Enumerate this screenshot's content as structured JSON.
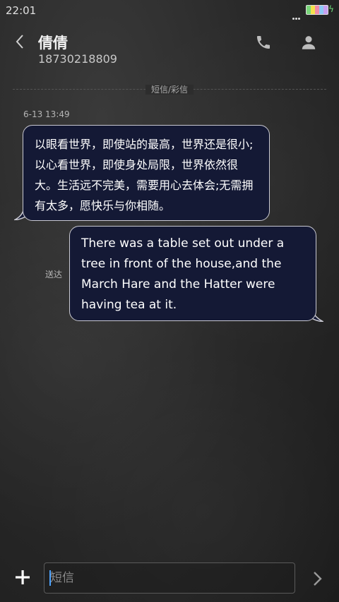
{
  "status_bar": {
    "time": "22:01"
  },
  "header": {
    "contact_name": "倩倩",
    "phone_number": "18730218809"
  },
  "channel": {
    "label": "短信/彩信"
  },
  "messages": [
    {
      "direction": "incoming",
      "timestamp": "6-13 13:49",
      "text": "以眼看世界，即使站的最高，世界还是很小;以心看世界，即使身处局限，世界依然很大。生活远不完美，需要用心去体会;无需拥有太多，愿快乐与你相随。"
    },
    {
      "direction": "outgoing",
      "status": "送达",
      "text": "There was a table set out under a tree in front of the house,and the March Hare and the Hatter were having tea at it."
    }
  ],
  "composer": {
    "placeholder": "短信"
  },
  "icons": {
    "back": "chevron-left-icon",
    "call": "phone-icon",
    "profile": "person-icon",
    "add": "plus-icon",
    "send": "chevron-right-icon"
  },
  "colors": {
    "bubble_fill": "#141935",
    "bubble_border": "#c9c9d2",
    "background": "#2a2a2a",
    "caret": "#4da3ff"
  }
}
